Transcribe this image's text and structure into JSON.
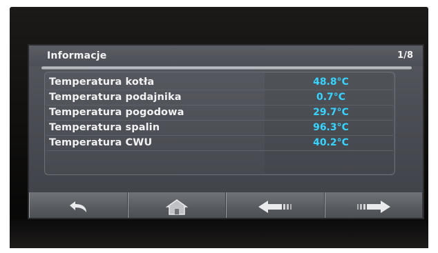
{
  "header": {
    "title": "Informacje",
    "page_indicator": "1/8"
  },
  "rows": [
    {
      "label": "Temperatura kotła",
      "value": "48.8°C"
    },
    {
      "label": "Temperatura podajnika",
      "value": "0.7°C"
    },
    {
      "label": "Temperatura pogodowa",
      "value": "29.7°C"
    },
    {
      "label": "Temperatura spalin",
      "value": "96.3°C"
    },
    {
      "label": "Temperatura CWU",
      "value": "40.2°C"
    }
  ],
  "buttons": [
    {
      "icon": "back-arrow-icon"
    },
    {
      "icon": "home-icon"
    },
    {
      "icon": "previous-arrow-icon"
    },
    {
      "icon": "next-arrow-icon"
    }
  ],
  "colors": {
    "value_text": "#37d4ff",
    "label_text": "#f2f2f2",
    "screen_bg": "#4a4d53"
  }
}
